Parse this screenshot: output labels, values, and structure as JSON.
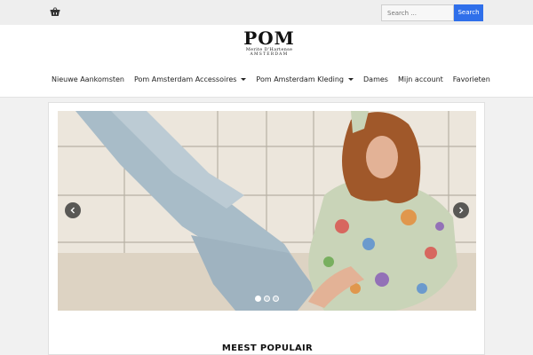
{
  "topbar": {
    "basket_icon": "basket-icon",
    "search_placeholder": "Search ...",
    "search_button": "Search"
  },
  "logo": {
    "main": "POM",
    "line1": "Merite D'Hartense",
    "line2": "AMSTERDAM"
  },
  "nav": {
    "items": [
      {
        "label": "Nieuwe Aankomsten",
        "dropdown": false
      },
      {
        "label": "Pom Amsterdam Accessoires",
        "dropdown": true
      },
      {
        "label": "Pom Amsterdam Kleding",
        "dropdown": true
      },
      {
        "label": "Dames",
        "dropdown": false
      },
      {
        "label": "Mijn account",
        "dropdown": false
      },
      {
        "label": "Favorieten",
        "dropdown": false
      }
    ]
  },
  "slider": {
    "prev_icon": "chevron-left-icon",
    "next_icon": "chevron-right-icon",
    "slide_count": 3,
    "active_slide": 1
  },
  "section": {
    "title": "MEEST POPULAIR"
  },
  "colors": {
    "accent": "#2f6fea",
    "topbar_bg": "#eeeeee",
    "page_bg": "#f1f1f1"
  }
}
